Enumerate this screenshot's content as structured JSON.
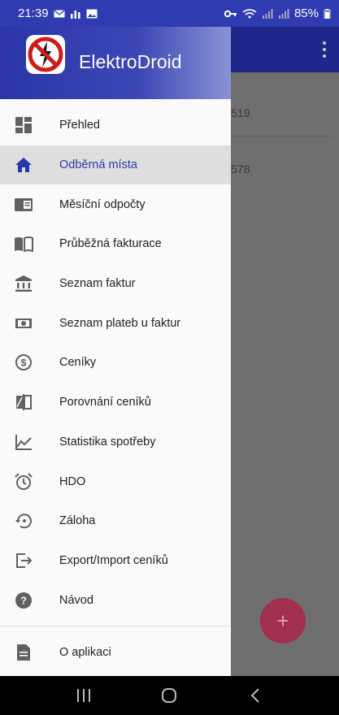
{
  "status_bar": {
    "time": "21:39",
    "battery": "85%",
    "left_icons": [
      "mail-icon",
      "signal-bars-icon",
      "image-icon"
    ],
    "right_icons": [
      "key-icon",
      "wifi-icon",
      "cell-signal-icon",
      "cell-signal-icon-2",
      "battery-icon"
    ]
  },
  "drawer": {
    "app_name": "ElektroDroid",
    "logo_icon": "no-electricity-sign-icon",
    "items": [
      {
        "label": "Přehled",
        "icon": "dashboard-icon",
        "active": false
      },
      {
        "label": "Odběrná místa",
        "icon": "home-icon",
        "active": true
      },
      {
        "label": "Měsíční odpočty",
        "icon": "monthly-readings-icon",
        "active": false
      },
      {
        "label": "Průběžná fakturace",
        "icon": "book-icon",
        "active": false
      },
      {
        "label": "Seznam faktur",
        "icon": "bank-icon",
        "active": false
      },
      {
        "label": "Seznam plateb u faktur",
        "icon": "money-icon",
        "active": false
      },
      {
        "label": "Ceníky",
        "icon": "dollar-coin-icon",
        "active": false
      },
      {
        "label": "Porovnání ceníků",
        "icon": "compare-icon",
        "active": false
      },
      {
        "label": "Statistika spotřeby",
        "icon": "chart-line-icon",
        "active": false
      },
      {
        "label": "HDO",
        "icon": "alarm-clock-icon",
        "active": false
      },
      {
        "label": "Záloha",
        "icon": "backup-restore-icon",
        "active": false
      },
      {
        "label": "Export/Import ceníků",
        "icon": "export-icon",
        "active": false
      },
      {
        "label": "Návod",
        "icon": "help-icon",
        "active": false
      }
    ],
    "footer_item": {
      "label": "O aplikaci",
      "icon": "document-icon"
    }
  },
  "background": {
    "rows": [
      "519",
      "578"
    ],
    "fab_label": "+"
  },
  "colors": {
    "primary": "#2f3bb0",
    "accent_fab": "#c2185b",
    "active_text": "#2b3aa8"
  }
}
